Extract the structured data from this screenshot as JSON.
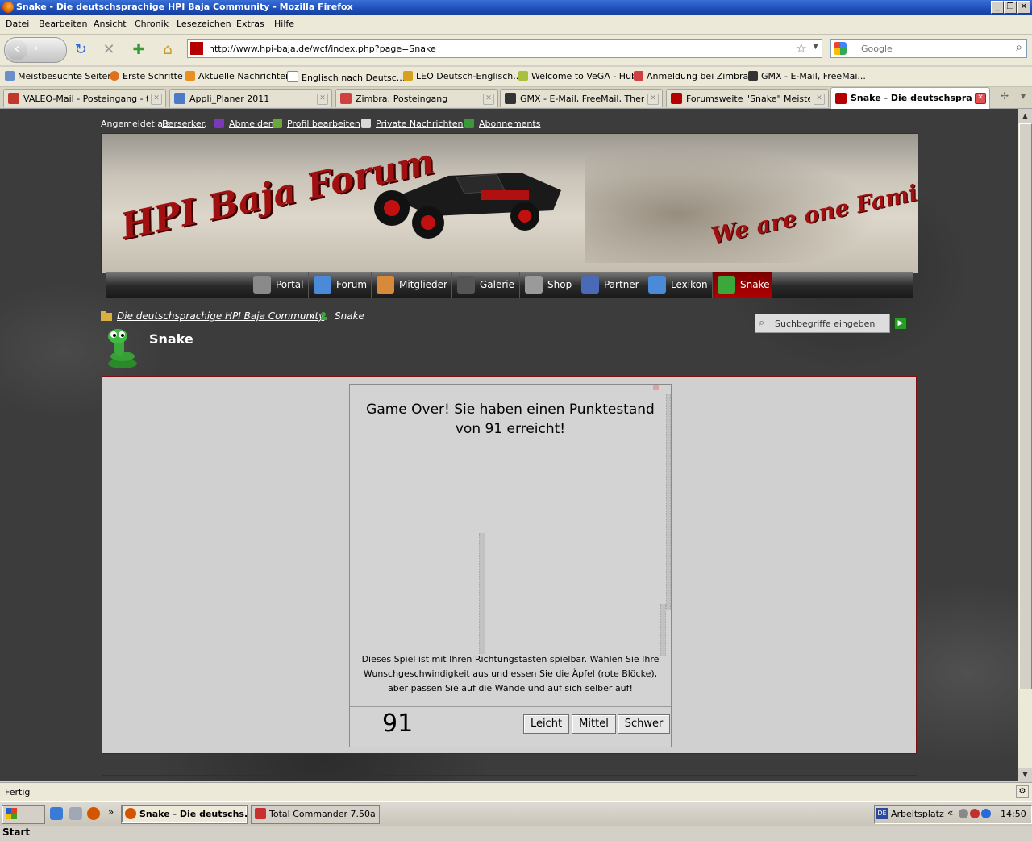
{
  "window": {
    "title": "Snake - Die deutschsprachige HPI Baja Community - Mozilla Firefox"
  },
  "menu": [
    "Datei",
    "Bearbeiten",
    "Ansicht",
    "Chronik",
    "Lesezeichen",
    "Extras",
    "Hilfe"
  ],
  "navigation": {
    "url": "http://www.hpi-baja.de/wcf/index.php?page=Snake",
    "search_placeholder": "Google"
  },
  "bookmarks": [
    "Meistbesuchte Seiten",
    "Erste Schritte",
    "Aktuelle Nachrichten",
    "Englisch nach Deutsc...",
    "LEO Deutsch-Englisch...",
    "Welcome to VeGA - Hub",
    "Anmeldung bei Zimbra...",
    "GMX - E-Mail, FreeMai..."
  ],
  "tabs": [
    {
      "title": "VALEO-Mail - Posteingang - to...",
      "color": "#c0392b"
    },
    {
      "title": "Appli_Planer 2011",
      "color": "#4a7ac8"
    },
    {
      "title": "Zimbra: Posteingang",
      "color": "#d04040"
    },
    {
      "title": "GMX - E-Mail, FreeMail, Them...",
      "color": "#333333"
    },
    {
      "title": "Forumsweite \"Snake\" Meister...",
      "color": "#b40000"
    },
    {
      "title": "Snake - Die deutschspra...",
      "color": "#b40000",
      "active": true
    }
  ],
  "userbar": {
    "logged_in_as": "Angemeldet als",
    "username": "Berserker",
    "logout": "Abmelden",
    "edit_profile": "Profil bearbeiten",
    "private_messages": "Private Nachrichten",
    "subscriptions": "Abonnements"
  },
  "banner": {
    "title": "HPI Baja Forum",
    "slogan": "We are one Family!"
  },
  "mainnav": [
    {
      "label": "Portal",
      "icon": "laptop-icon",
      "color": "#8a8a8a"
    },
    {
      "label": "Forum",
      "icon": "forum-icon",
      "color": "#4a8ad8"
    },
    {
      "label": "Mitglieder",
      "icon": "members-icon",
      "color": "#d88a3a"
    },
    {
      "label": "Galerie",
      "icon": "camera-icon",
      "color": "#555555"
    },
    {
      "label": "Shop",
      "icon": "shop-icon",
      "color": "#9a9a9a"
    },
    {
      "label": "Partner",
      "icon": "partner-icon",
      "color": "#4a6ab8"
    },
    {
      "label": "Lexikon",
      "icon": "book-icon",
      "color": "#4a8ad8"
    },
    {
      "label": "Snake",
      "icon": "snake-icon",
      "color": "#3aa83a",
      "active": true
    }
  ],
  "breadcrumb": {
    "home": "Die deutschsprachige HPI Baja Community",
    "separator": "»",
    "current": "Snake"
  },
  "page": {
    "title": "Snake",
    "search_placeholder": "Suchbegriffe eingeben"
  },
  "game": {
    "message_line1": "Game Over! Sie haben einen Punktestand",
    "message_line2": "von 91 erreicht!",
    "help_line1": "Dieses Spiel ist mit Ihren Richtungstasten spielbar. Wählen Sie Ihre",
    "help_line2": "Wunschgeschwindigkeit aus und essen Sie die Äpfel (rote Blöcke),",
    "help_line3": "aber passen Sie auf die Wände und auf sich selber auf!",
    "score": "91",
    "buttons": {
      "easy": "Leicht",
      "medium": "Mittel",
      "hard": "Schwer"
    }
  },
  "status": {
    "text": "Fertig"
  },
  "taskbar": {
    "start": "Start",
    "tasks": [
      {
        "label": "Snake - Die deutschs...",
        "active": true,
        "color": "#d45500"
      },
      {
        "label": "Total Commander 7.50a ...",
        "active": false,
        "color": "#c83030"
      }
    ],
    "tray_label": "Arbeitsplatz",
    "clock": "14:50"
  }
}
